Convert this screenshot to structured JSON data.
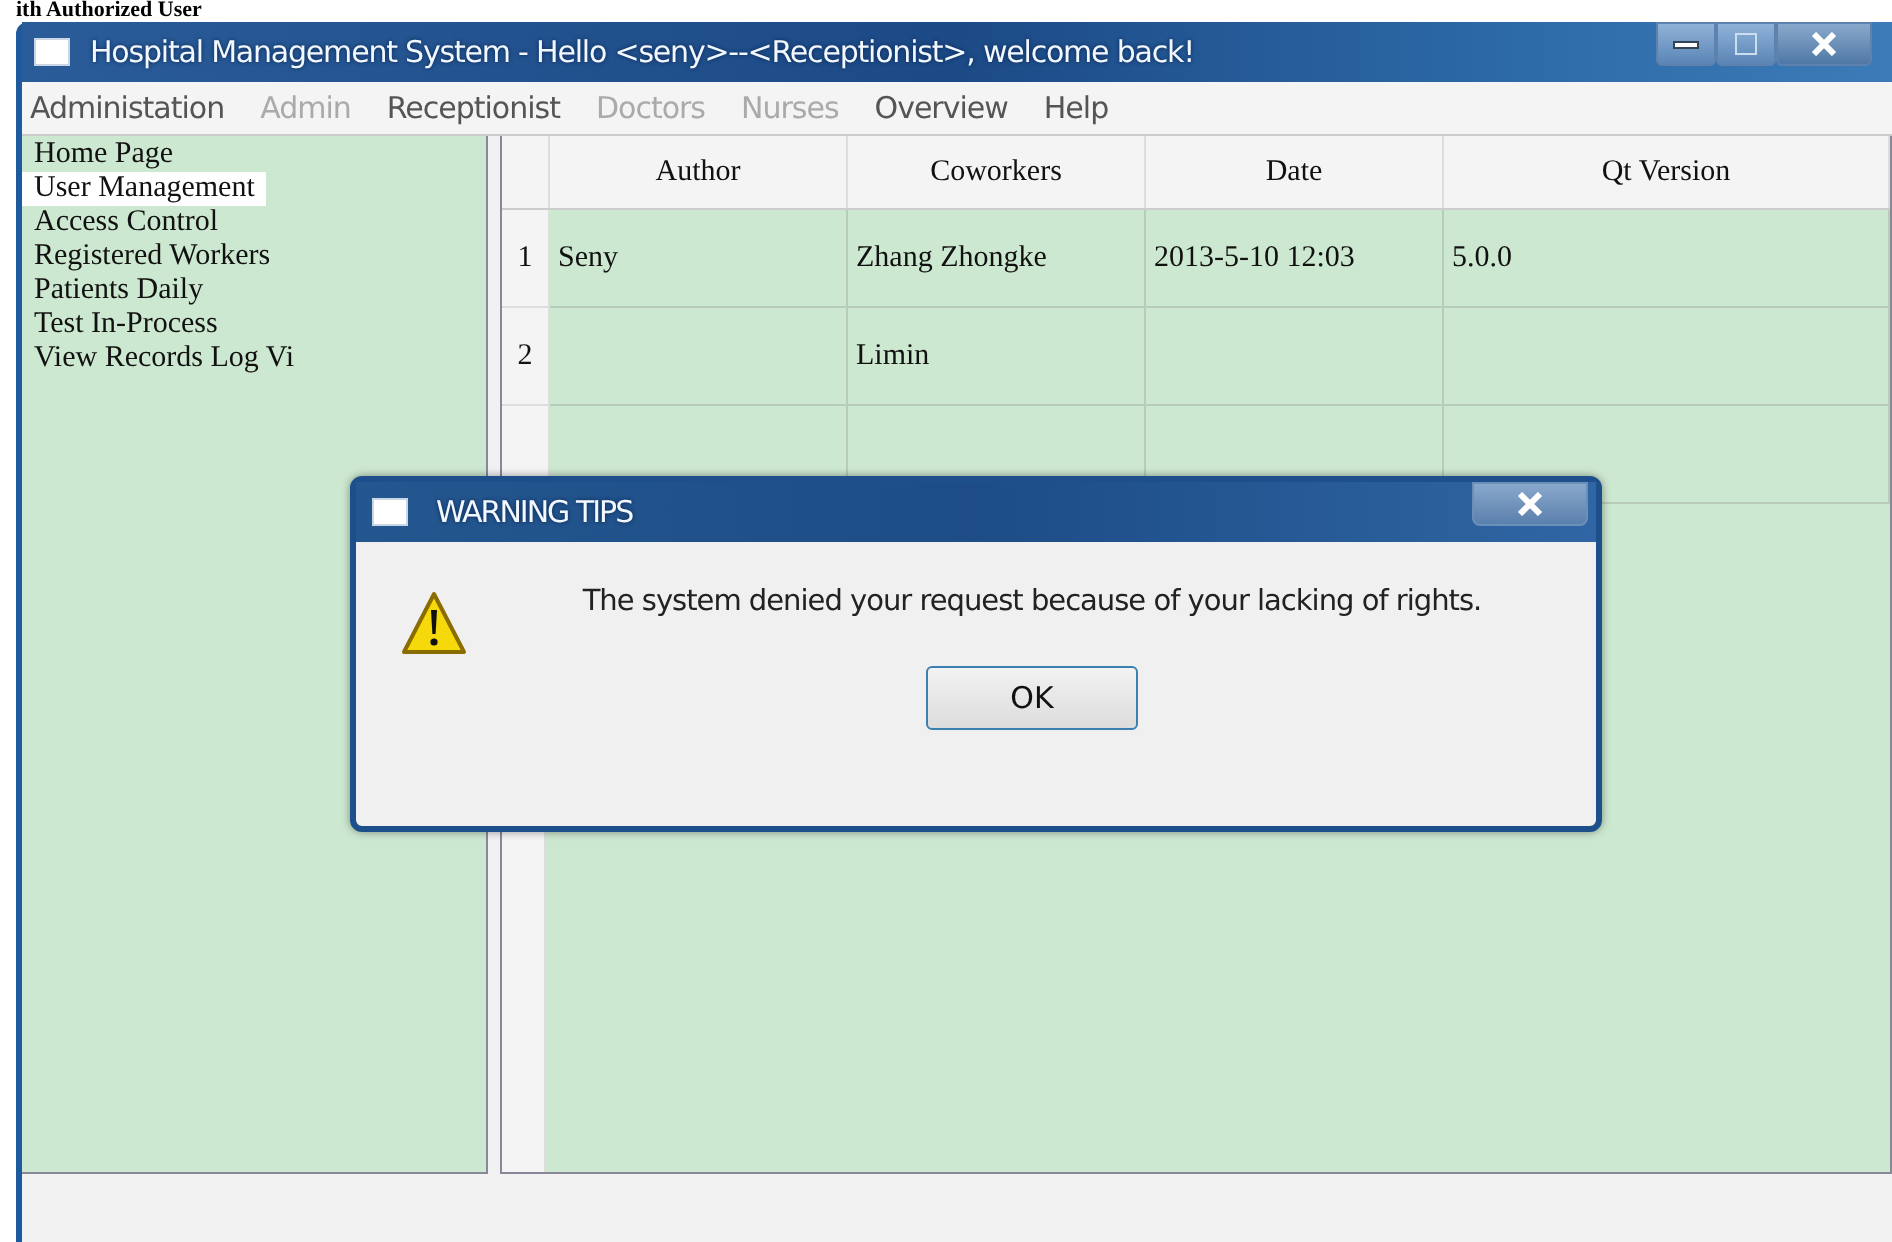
{
  "caption": "ith Authorized User",
  "window": {
    "title": "Hospital Management System - Hello <seny>--<Receptionist>, welcome back!"
  },
  "menu": [
    {
      "label": "Administation",
      "disabled": false
    },
    {
      "label": "Admin",
      "disabled": true
    },
    {
      "label": "Receptionist",
      "disabled": false
    },
    {
      "label": "Doctors",
      "disabled": true
    },
    {
      "label": "Nurses",
      "disabled": true
    },
    {
      "label": "Overview",
      "disabled": false
    },
    {
      "label": "Help",
      "disabled": false
    }
  ],
  "sidebar": {
    "items": [
      {
        "label": "Home Page",
        "selected": false
      },
      {
        "label": "User Management",
        "selected": true
      },
      {
        "label": "Access Control",
        "selected": false
      },
      {
        "label": "Registered Workers",
        "selected": false
      },
      {
        "label": "Patients Daily",
        "selected": false
      },
      {
        "label": "Test In-Process",
        "selected": false
      },
      {
        "label": "View Records  Log Vi",
        "selected": false
      }
    ]
  },
  "table": {
    "columns": [
      "Author",
      "Coworkers",
      "Date",
      "Qt Version"
    ],
    "rows": [
      {
        "number": "1",
        "cells": [
          "Seny",
          "Zhang Zhongke",
          "2013-5-10 12:03",
          "5.0.0"
        ]
      },
      {
        "number": "2",
        "cells": [
          null,
          "Limin",
          null,
          null
        ]
      }
    ]
  },
  "dialog": {
    "title": "WARNING TIPS",
    "message": "The system denied your request because of your lacking of rights.",
    "button": "OK"
  }
}
